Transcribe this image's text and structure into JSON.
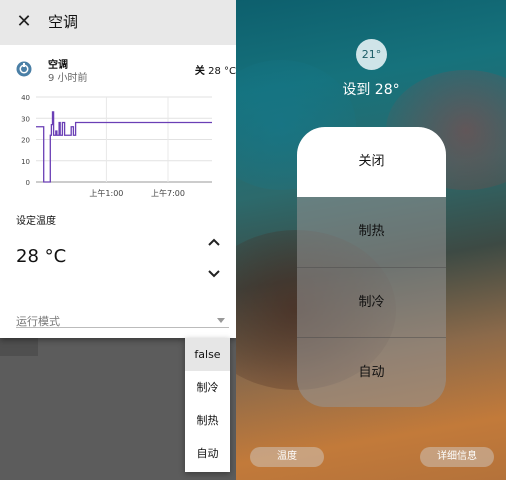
{
  "dialog": {
    "title": "空调",
    "close_icon": "close-icon",
    "entity": {
      "name": "空调",
      "last_changed": "9 小时前",
      "state_mode": "关",
      "state_temp": "28 °C",
      "icon": "thermostat-icon"
    },
    "setpoint": {
      "label": "设定温度",
      "value": "28 °C",
      "up_icon": "chevron-up-icon",
      "down_icon": "chevron-down-icon"
    },
    "mode_select": {
      "label": "运行模式",
      "icon": "dropdown-arrow-icon"
    }
  },
  "mode_menu": {
    "items": [
      "false",
      "制冷",
      "制热",
      "自动"
    ],
    "selected": "false"
  },
  "chart_data": {
    "type": "line",
    "title": "",
    "ylim": [
      0,
      40
    ],
    "y_ticks": [
      "40",
      "30",
      "20",
      "10",
      "0"
    ],
    "x_ticks": [
      "上午1:00",
      "上午7:00"
    ],
    "grid": true,
    "line_color": "#6a3fb5",
    "x": [
      0,
      0.35,
      0.7,
      0.9,
      1.1,
      1.3,
      1.4,
      1.5,
      1.6,
      1.7,
      1.8,
      1.9,
      2.0,
      2.1,
      2.2,
      2.4,
      2.6,
      2.8,
      3.0,
      3.2,
      3.4,
      3.6,
      3.8,
      4.0,
      16.0
    ],
    "values": [
      26,
      26,
      0,
      0,
      0,
      22,
      27,
      33,
      22,
      22,
      24,
      22,
      22,
      28,
      22,
      28,
      22,
      22,
      22,
      26,
      22,
      28,
      28,
      28,
      28
    ]
  },
  "control_center": {
    "current_temp": "21°",
    "target_label": "设到 28°",
    "modes": [
      "关闭",
      "制热",
      "制冷",
      "自动"
    ],
    "active_mode": "关闭",
    "temp_button": "温度",
    "detail_button": "详细信息"
  }
}
